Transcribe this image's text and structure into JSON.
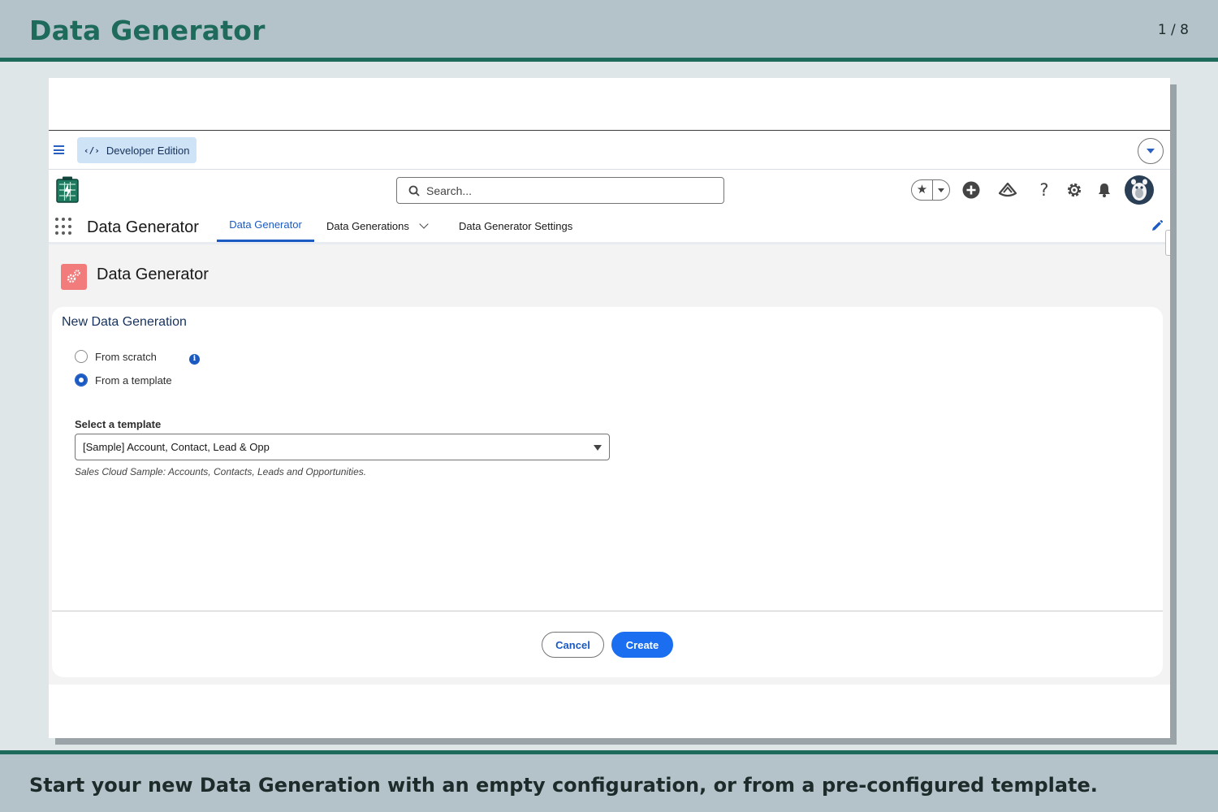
{
  "slide": {
    "title": "Data Generator",
    "counter": "1 / 8",
    "caption": "Start your new Data Generation with an empty configuration, or from a pre-configured template."
  },
  "dev_bar": {
    "badge_label": "Developer Edition"
  },
  "header": {
    "search_placeholder": "Search..."
  },
  "nav": {
    "app_name": "Data Generator",
    "tabs": [
      {
        "label": "Data Generator",
        "active": true
      },
      {
        "label": "Data Generations",
        "has_dropdown": true
      },
      {
        "label": "Data Generator Settings"
      }
    ]
  },
  "page": {
    "title": "Data Generator"
  },
  "form": {
    "title": "New Data Generation",
    "options": [
      {
        "label": "From scratch",
        "checked": false
      },
      {
        "label": "From a template",
        "checked": true
      }
    ],
    "template_label": "Select a template",
    "template_value": "[Sample] Account, Contact, Lead & Opp",
    "template_help": "Sales Cloud Sample: Accounts, Contacts, Leads and Opportunities.",
    "cancel_label": "Cancel",
    "create_label": "Create"
  },
  "colors": {
    "brand": "#1e6a5b",
    "accent": "#1b5ac2",
    "primary_button": "#1b6ef0"
  }
}
